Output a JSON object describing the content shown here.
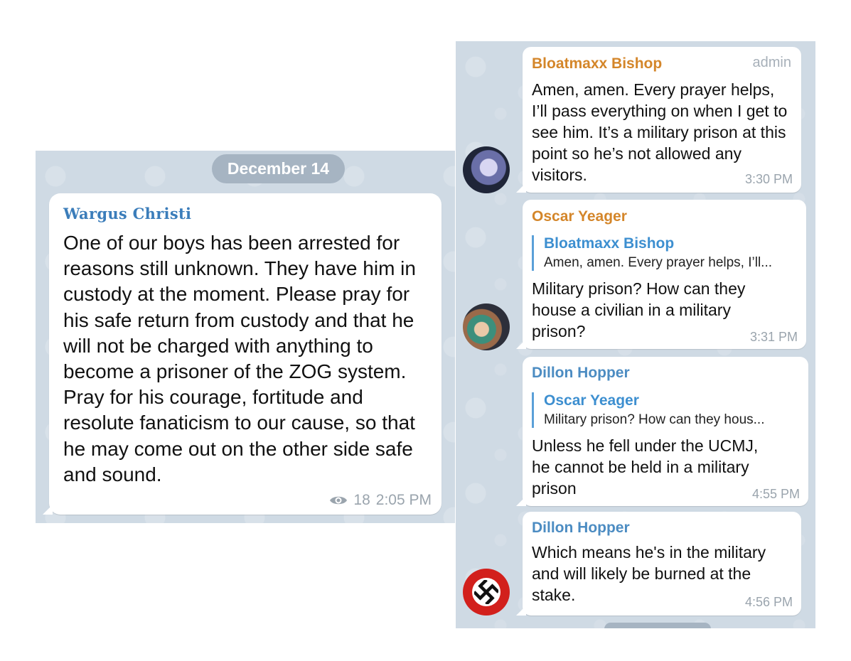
{
  "date_pill": "December 14",
  "main_post": {
    "channel": "Wargus Christi",
    "text": "One of our boys has been arrested for reasons still unknown. They have him in custody at the moment. Please pray for his safe return from custody and that he will not be charged with anything to become a prisoner of the ZOG system. Pray for his courage, fortitude and resolute fanaticism to our cause, so that he may come out on the other side safe and sound.",
    "views": "18",
    "time": "2:05 PM"
  },
  "messages": [
    {
      "sender": "Bloatmaxx Bishop",
      "badge": "admin",
      "text": "Amen, amen. Every prayer helps, I’ll pass everything on when I get to see him. It’s a military prison at this point so he’s not allowed any visitors.",
      "time": "3:30 PM",
      "color": "#d4862a"
    },
    {
      "sender": "Oscar Yeager",
      "reply_to_name": "Bloatmaxx Bishop",
      "reply_to_text": "Amen, amen. Every prayer helps, I’ll...",
      "text": "Military prison? How can they house a civilian in a military prison?",
      "time": "3:31 PM",
      "color": "#d4862a"
    },
    {
      "sender": "Dillon Hopper",
      "reply_to_name": "Oscar Yeager",
      "reply_to_text": "Military prison? How can they hous...",
      "text": "Unless he fell under the UCMJ, he cannot be held in a military prison",
      "time": "4:55 PM",
      "color": "#4c8cc2"
    },
    {
      "sender": "Dillon Hopper",
      "text": "Which means he's in the military and will likely be burned at the stake.",
      "time": "4:56 PM",
      "color": "#4c8cc2"
    }
  ],
  "colors": {
    "wallpaper": "#cfdae4",
    "pill": "#a6b4c2",
    "link_blue": "#3d8fd0"
  }
}
